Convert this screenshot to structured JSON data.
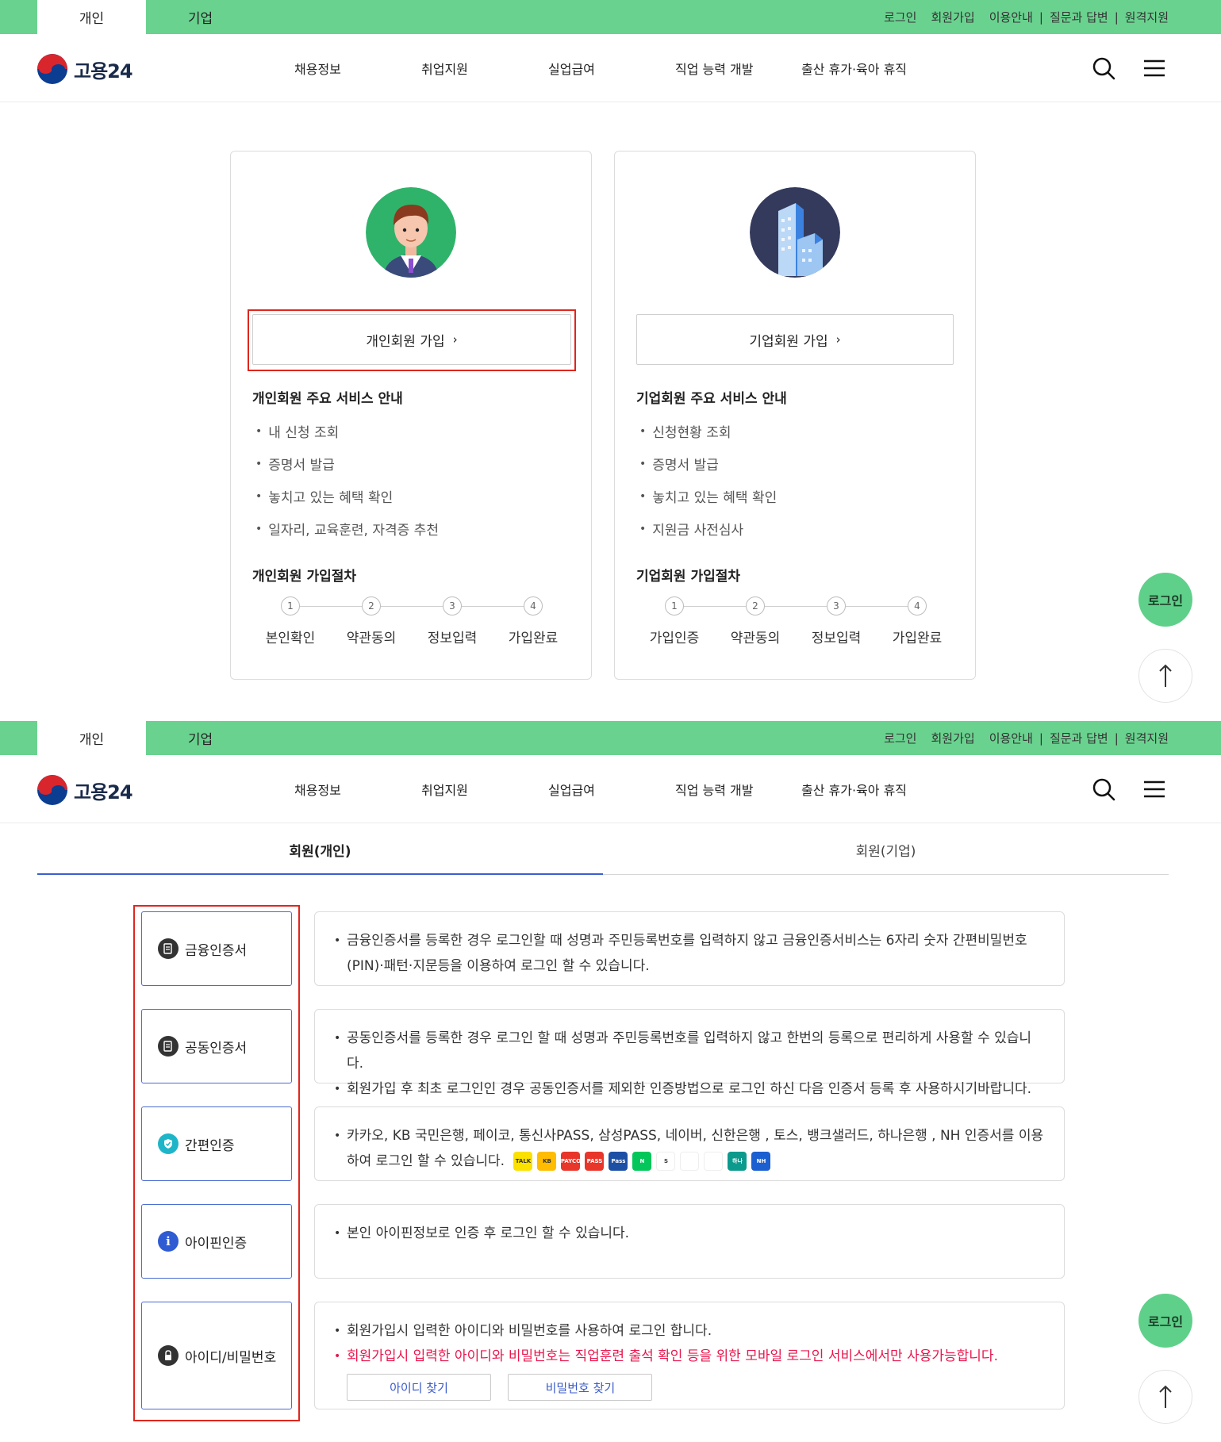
{
  "top": {
    "tabs": [
      "개인",
      "기업"
    ],
    "utils": [
      "로그인",
      "회원가입",
      "이용안내",
      "질문과 답변",
      "원격지원"
    ]
  },
  "header": {
    "logo_text": "고용24",
    "nav": [
      "채용정보",
      "취업지원",
      "실업급여",
      "직업 능력 개발",
      "출산 휴가·육아 휴직"
    ]
  },
  "join": {
    "personal": {
      "button": "개인회원 가입",
      "services_title": "개인회원 주요 서비스 안내",
      "services": [
        "내 신청 조회",
        "증명서 발급",
        "놓치고 있는 혜택 확인",
        "일자리, 교육훈련, 자격증 추천"
      ],
      "steps_title": "개인회원 가입절차",
      "steps": [
        {
          "num": "1",
          "label": "본인확인"
        },
        {
          "num": "2",
          "label": "약관동의"
        },
        {
          "num": "3",
          "label": "정보입력"
        },
        {
          "num": "4",
          "label": "가입완료"
        }
      ]
    },
    "corporate": {
      "button": "기업회원 가입",
      "services_title": "기업회원 주요 서비스 안내",
      "services": [
        "신청현황 조회",
        "증명서 발급",
        "놓치고 있는 혜택 확인",
        "지원금 사전심사"
      ],
      "steps_title": "기업회원 가입절차",
      "steps": [
        {
          "num": "1",
          "label": "가입인증"
        },
        {
          "num": "2",
          "label": "약관동의"
        },
        {
          "num": "3",
          "label": "정보입력"
        },
        {
          "num": "4",
          "label": "가입완료"
        }
      ]
    }
  },
  "floating": {
    "login": "로그인",
    "top_icon": "arrow-up-icon"
  },
  "member_tabs": {
    "personal": "회원(개인)",
    "corporate": "회원(기업)"
  },
  "methods": [
    {
      "label": "금융인증서",
      "icon": "certificate-icon",
      "desc": [
        "금융인증서를 등록한 경우 로그인할 때 성명과 주민등록번호를 입력하지 않고 금융인증서비스는 6자리 숫자 간편비밀번호(PIN)·패턴·지문등을 이용하여 로그인 할 수 있습니다."
      ]
    },
    {
      "label": "공동인증서",
      "icon": "certificate-icon",
      "desc": [
        "공동인증서를 등록한 경우 로그인 할 때 성명과 주민등록번호를 입력하지 않고 한번의 등록으로 편리하게 사용할 수 있습니다.",
        "회원가입 후 최초 로그인인 경우 공동인증서를 제외한 인증방법으로 로그인 하신 다음 인증서 등록 후 사용하시기바랍니다."
      ]
    },
    {
      "label": "간편인증",
      "icon": "shield-check-icon",
      "desc": [
        "카카오, KB 국민은행, 페이코, 통신사PASS, 삼성PASS, 네이버, 신한은행 , 토스, 뱅크샐러드, 하나은행 , NH 인증서를 이용하여 로그인 할 수 있습니다."
      ]
    },
    {
      "label": "아이핀인증",
      "icon": "info-icon",
      "desc": [
        "본인 아이핀정보로 인증 후 로그인 할 수 있습니다."
      ]
    },
    {
      "label": "아이디/비밀번호",
      "icon": "lock-icon",
      "desc": [
        "회원가입시 입력한 아이디와 비밀번호를 사용하여 로그인 합니다.",
        "회원가입시 입력한 아이디와 비밀번호는 직업훈련 출석 확인 등을 위한 모바일 로그인 서비스에서만 사용가능합니다."
      ]
    }
  ],
  "brand_icons": [
    {
      "name": "kakao-icon",
      "text": "TALK",
      "color": "#fae100"
    },
    {
      "name": "kb-icon",
      "text": "KB",
      "color": "#ffbc00"
    },
    {
      "name": "payco-icon",
      "text": "PAYCO",
      "color": "#e8362b"
    },
    {
      "name": "pass-icon",
      "text": "PASS",
      "color": "#e8362b"
    },
    {
      "name": "samsung-pass-icon",
      "text": "Pass",
      "color": "#1d4fa5"
    },
    {
      "name": "naver-icon",
      "text": "N",
      "color": "#03c75a"
    },
    {
      "name": "shinhan-icon",
      "text": "S",
      "color": "#ffffff"
    },
    {
      "name": "toss-icon",
      "text": "",
      "color": "#ffffff"
    },
    {
      "name": "banksalad-icon",
      "text": "",
      "color": "#ffffff"
    },
    {
      "name": "hana-icon",
      "text": "하나",
      "color": "#0c9a8d"
    },
    {
      "name": "nh-icon",
      "text": "NH",
      "color": "#1c5fd0"
    }
  ],
  "find_buttons": {
    "id": "아이디 찾기",
    "password": "비밀번호 찾기"
  },
  "colors": {
    "green": "#6ad28f",
    "accent_blue": "#4b6dd1",
    "highlight_red": "#e0261e",
    "warning_pink": "#e8174d"
  }
}
